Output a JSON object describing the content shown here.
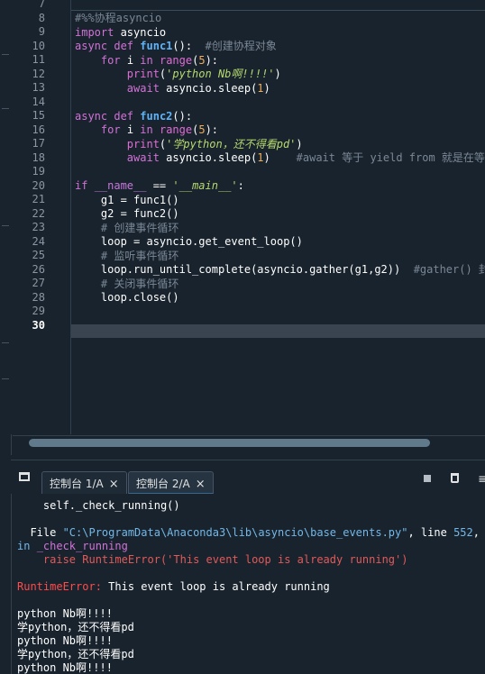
{
  "editor": {
    "line_numbers": [
      "7",
      "8",
      "9",
      "10",
      "11",
      "12",
      "13",
      "14",
      "15",
      "16",
      "17",
      "18",
      "19",
      "20",
      "21",
      "22",
      "23",
      "24",
      "25",
      "26",
      "27",
      "28",
      "29",
      "30"
    ],
    "current_line": "30",
    "code_lines": [
      "#%%协程asyncio",
      "import asyncio",
      "async def func1():  #创建协程对象",
      "    for i in range(5):",
      "        print('python Nb啊!!!!')",
      "        await asyncio.sleep(1)",
      "",
      "async def func2():",
      "    for i in range(5):",
      "        print('学python，还不得看pd')",
      "        await asyncio.sleep(1)    #await 等于 yield from 就是在等待",
      "",
      "if __name__ == '__main__':",
      "    g1 = func1()",
      "    g2 = func2()",
      "    # 创建事件循环",
      "    loop = asyncio.get_event_loop()",
      "    # 监听事件循环",
      "    loop.run_until_complete(asyncio.gather(g1,g2))  #gather() 封装",
      "    # 关闭事件循环",
      "    loop.close()",
      "",
      ""
    ]
  },
  "console": {
    "tabs": [
      {
        "label": "控制台 1/A",
        "close": "×"
      },
      {
        "label": "控制台 2/A",
        "close": "×"
      }
    ],
    "lines": [
      "    self._check_running()",
      "",
      "  File \"C:\\ProgramData\\Anaconda3\\lib\\asyncio\\base_events.py\", line 552,",
      "in _check_running",
      "    raise RuntimeError('This event loop is already running')",
      "",
      "RuntimeError: This event loop is already running",
      "",
      "python Nb啊!!!!",
      "学python，还不得看pd",
      "python Nb啊!!!!",
      "学python，还不得看pd",
      "python Nb啊!!!!"
    ],
    "file_path": "\"C:\\ProgramData\\Anaconda3\\lib\\asyncio\\base_events.py\"",
    "line_word": ", line ",
    "line_num": "552",
    "in_word": "in",
    "func_name": "_check_running",
    "err_label": "RuntimeError:",
    "err_msg": " This event loop is already running"
  }
}
